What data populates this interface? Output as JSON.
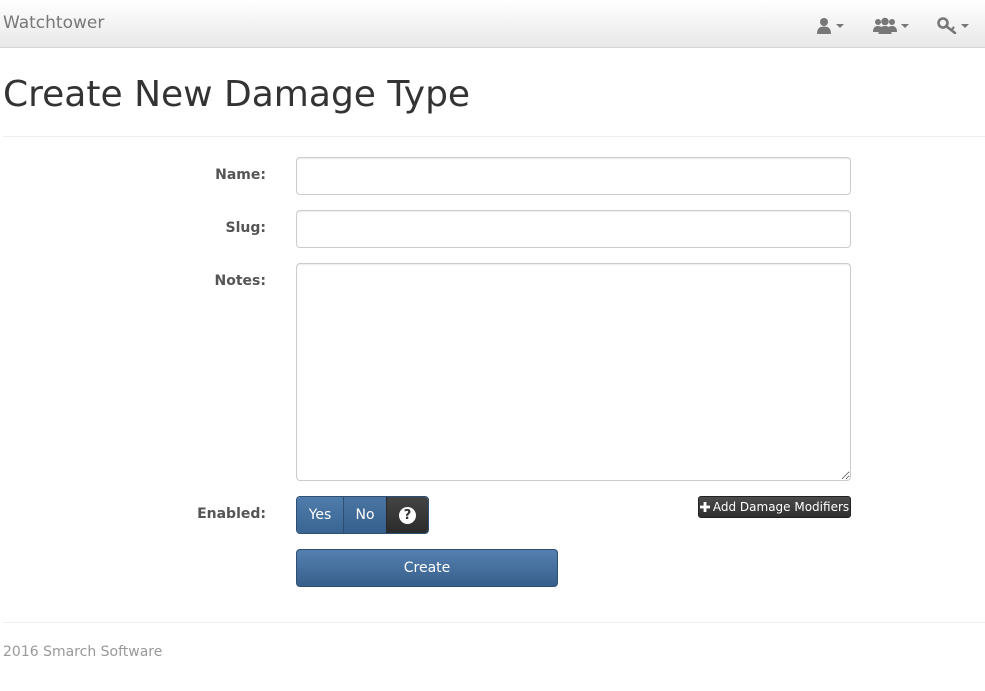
{
  "navbar": {
    "brand": "Watchtower",
    "menus": [
      {
        "icon": "user-icon"
      },
      {
        "icon": "users-icon"
      },
      {
        "icon": "key-icon"
      }
    ]
  },
  "page": {
    "title": "Create New Damage Type"
  },
  "form": {
    "name_label": "Name:",
    "name_value": "",
    "slug_label": "Slug:",
    "slug_value": "",
    "notes_label": "Notes:",
    "notes_value": "",
    "enabled_label": "Enabled:",
    "enabled_yes": "Yes",
    "enabled_no": "No",
    "help_glyph": "?",
    "add_modifiers_label": "Add Damage Modifiers",
    "create_label": "Create"
  },
  "footer": {
    "text": "2016 Smarch Software"
  },
  "colors": {
    "primary": "#3f6a99",
    "dark_button": "#333333",
    "navbar_bg": "#f2f2f2",
    "footer_text": "#999999"
  }
}
